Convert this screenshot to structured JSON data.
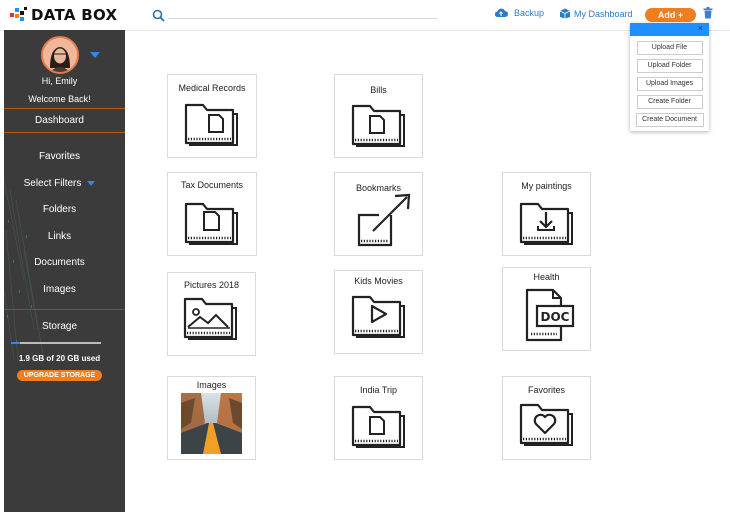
{
  "app": {
    "logo_text": "DATA BOX"
  },
  "header": {
    "search_placeholder": "",
    "backup_label": "Backup",
    "dashboard_label": "My Dashboard",
    "add_label": "Add +"
  },
  "add_menu": {
    "close": "×",
    "items": [
      "Upload File",
      "Upload Folder",
      "Upload Images",
      "Create Folder",
      "Create Document"
    ]
  },
  "sidebar": {
    "greeting": "Hi, Emily",
    "welcome": "Welcome Back!",
    "nav": {
      "dashboard": "Dashboard",
      "favorites": "Favorites",
      "select_filters": "Select Filters",
      "folders": "Folders",
      "links": "Links",
      "documents": "Documents",
      "images": "Images"
    },
    "storage": {
      "title": "Storage",
      "used_text": "1.9 GB of 20 GB used",
      "used_fraction": 0.095,
      "upgrade_label": "UPGRADE STORAGE"
    }
  },
  "folders": [
    {
      "label": "Medical Records",
      "icon": "document-folder-icon"
    },
    {
      "label": "Bills",
      "icon": "document-folder-icon"
    },
    {
      "label": "Tax Documents",
      "icon": "document-folder-icon"
    },
    {
      "label": "Bookmarks",
      "icon": "bookmark-link-icon"
    },
    {
      "label": "My paintings",
      "icon": "download-folder-icon"
    },
    {
      "label": "Pictures 2018",
      "icon": "image-folder-icon"
    },
    {
      "label": "Kids Movies",
      "icon": "video-folder-icon"
    },
    {
      "label": "Health",
      "icon": "doc-file-icon"
    },
    {
      "label": "Images",
      "icon": "photo-thumbnail"
    },
    {
      "label": "India Trip",
      "icon": "document-folder-icon"
    },
    {
      "label": "Favorites",
      "icon": "heart-folder-icon"
    }
  ],
  "colors": {
    "accent_orange": "#f07d1e",
    "link_blue": "#2b7cc4",
    "sidebar_bg": "#3b3b3b",
    "menu_header_blue": "#1e90ff"
  }
}
